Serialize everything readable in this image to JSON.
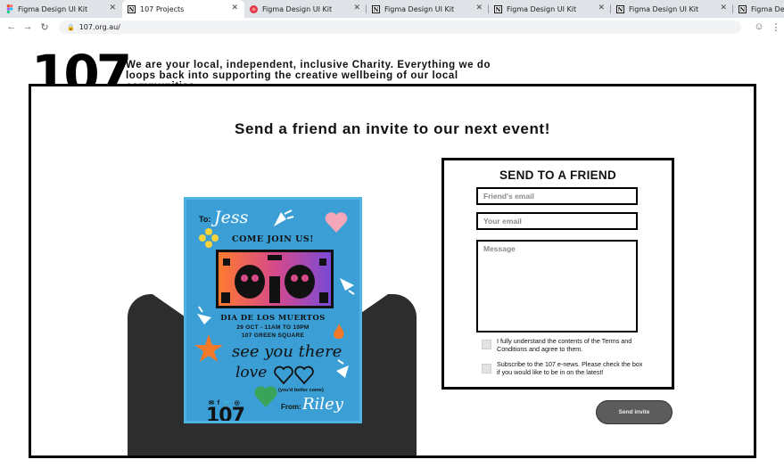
{
  "browser": {
    "tabs": [
      {
        "title": "Figma Design UI Kit",
        "icon": "figma-icon"
      },
      {
        "title": "107 Projects",
        "icon": "notion-icon",
        "active": true
      },
      {
        "title": "Figma Design UI Kit",
        "icon": "red-circle-icon"
      },
      {
        "title": "Figma Design UI Kit",
        "icon": "notion-icon"
      },
      {
        "title": "Figma Design UI Kit",
        "icon": "notion-icon"
      },
      {
        "title": "Figma Design UI Kit",
        "icon": "notion-icon"
      },
      {
        "title": "Figma De",
        "icon": "notion-icon"
      }
    ],
    "close_glyph": "✕",
    "url": "107.org.au/",
    "nav": {
      "back": "←",
      "forward": "→",
      "reload": "↻",
      "lock": "🔒",
      "profile": "☺",
      "menu": "⋮"
    }
  },
  "site": {
    "logo": "107",
    "tagline": "We are your local, independent, inclusive Charity. Everything we do loops back into supporting the creative wellbeing of our local communities."
  },
  "modal": {
    "title": "Send a friend an invite to our next event!"
  },
  "card": {
    "to_label": "To:",
    "to_name": "Jess",
    "headline": "COME JOIN US!",
    "event_name": "DIA DE LOS MUERTOS",
    "event_date": "29 OCT - 11AM TO 10PM",
    "event_place": "107 GREEN SQUARE",
    "message": "see you there",
    "signoff": "love",
    "note": "(you'd better come)",
    "from_label": "From:",
    "from_name": "Riley",
    "logo": "107",
    "social": "✉ f 🐦 ◎"
  },
  "form": {
    "title": "SEND TO A FRIEND",
    "friend_email_placeholder": "Friend's email",
    "your_email_placeholder": "Your email",
    "message_placeholder": "Message",
    "terms_label": "I fully understand the contents of the Terms and Conditions and agree to them.",
    "newsletter_label": "Subscribe to the 107 e-news. Please check the box if you would like to be in on the latest!",
    "send_label": "Send invite"
  },
  "colors": {
    "card_bg": "#3b9fd6",
    "envelope": "#2d2d2d",
    "send_button": "#5c5c5c"
  }
}
